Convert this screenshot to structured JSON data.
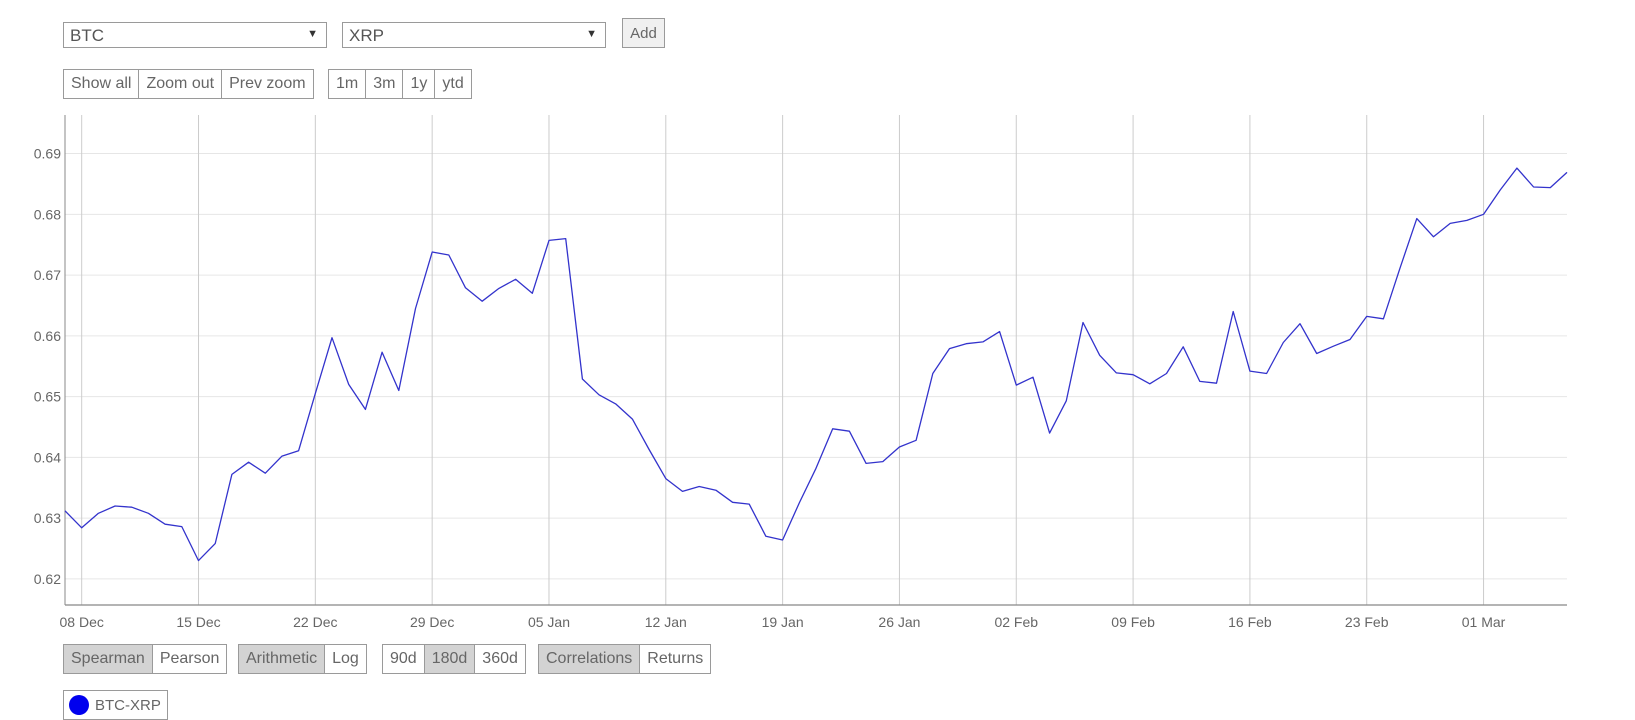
{
  "selectors": {
    "coin1": "BTC",
    "coin2": "XRP",
    "add_label": "Add"
  },
  "zoom_buttons": [
    "Show all",
    "Zoom out",
    "Prev zoom"
  ],
  "range_buttons": [
    "1m",
    "3m",
    "1y",
    "ytd"
  ],
  "toggles": {
    "method": [
      "Spearman",
      "Pearson"
    ],
    "scale": [
      "Arithmetic",
      "Log"
    ],
    "window": [
      "90d",
      "180d",
      "360d"
    ],
    "view": [
      "Correlations",
      "Returns"
    ]
  },
  "active": {
    "method": "Spearman",
    "scale": "Arithmetic",
    "window": "180d",
    "view": "Correlations"
  },
  "legend": {
    "label": "BTC-XRP",
    "color": "#0000ee"
  },
  "chart_data": {
    "type": "line",
    "title": "",
    "xlabel": "",
    "ylabel": "",
    "ylim": [
      0.6157,
      0.6947
    ],
    "grid": true,
    "legend_position": "bottom-left",
    "x_ticks": [
      "08 Dec",
      "15 Dec",
      "22 Dec",
      "29 Dec",
      "05 Jan",
      "12 Jan",
      "19 Jan",
      "26 Jan",
      "02 Feb",
      "09 Feb",
      "16 Feb",
      "23 Feb",
      "01 Mar"
    ],
    "y_ticks": [
      0.62,
      0.63,
      0.64,
      0.65,
      0.66,
      0.67,
      0.68,
      0.69
    ],
    "x_start": "2017-12-07",
    "series": [
      {
        "name": "BTC-XRP",
        "color": "#3333cc",
        "values": [
          0.6312,
          0.6284,
          0.6308,
          0.632,
          0.6318,
          0.6308,
          0.629,
          0.6286,
          0.623,
          0.6258,
          0.6372,
          0.6392,
          0.6374,
          0.6402,
          0.6411,
          0.6505,
          0.6597,
          0.652,
          0.6479,
          0.6573,
          0.651,
          0.6645,
          0.6738,
          0.6733,
          0.6679,
          0.6657,
          0.6678,
          0.6693,
          0.667,
          0.6757,
          0.676,
          0.6529,
          0.6503,
          0.6488,
          0.6463,
          0.6413,
          0.6365,
          0.6344,
          0.6352,
          0.6346,
          0.6326,
          0.6323,
          0.627,
          0.6264,
          0.6325,
          0.6382,
          0.6447,
          0.6443,
          0.639,
          0.6393,
          0.6417,
          0.6428,
          0.6538,
          0.6579,
          0.6587,
          0.659,
          0.6607,
          0.6519,
          0.6532,
          0.644,
          0.6493,
          0.6622,
          0.6568,
          0.6539,
          0.6536,
          0.6521,
          0.6538,
          0.6582,
          0.6525,
          0.6522,
          0.664,
          0.6542,
          0.6538,
          0.6589,
          0.662,
          0.6571,
          0.6583,
          0.6594,
          0.6632,
          0.6628,
          0.6712,
          0.6793,
          0.6763,
          0.6785,
          0.679,
          0.68,
          0.684,
          0.6876,
          0.6845,
          0.6844,
          0.6869
        ]
      }
    ]
  }
}
